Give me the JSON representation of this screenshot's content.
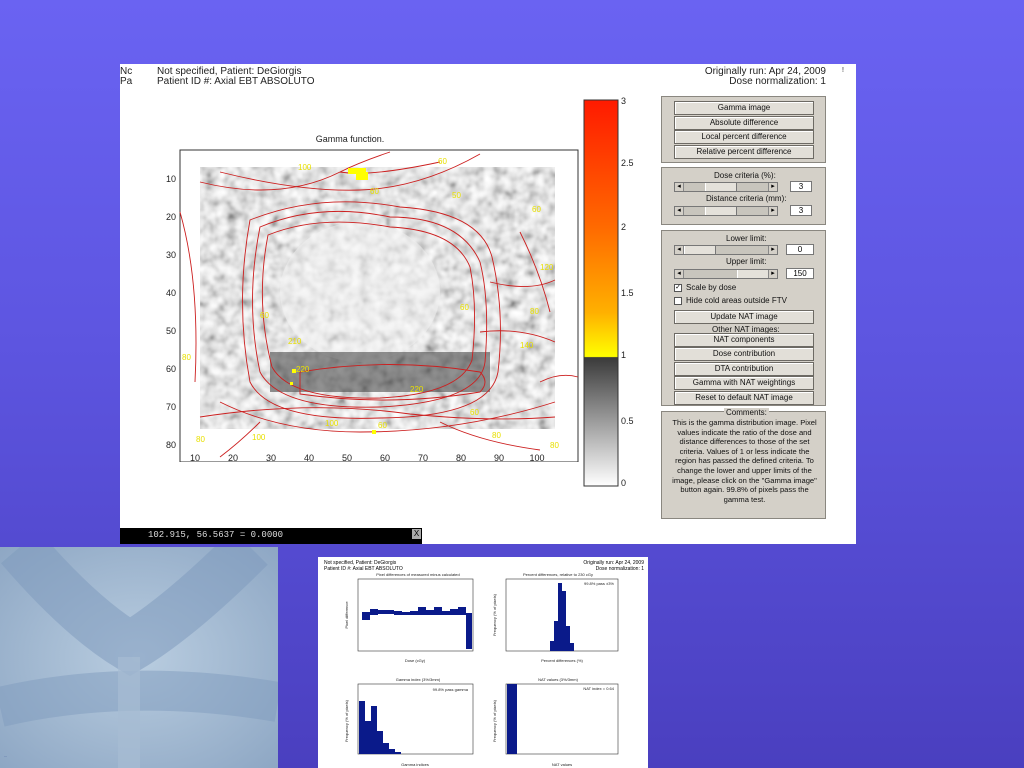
{
  "header": {
    "left_cut_1": "Nc",
    "left_cut_2": "Pa",
    "line1": "Not specified, Patient: DeGiorgis",
    "line2": "Patient ID #: Axial EBT ABSOLUTO",
    "orig_run": "Originally run: Apr 24, 2009",
    "dose_norm": "Dose normalization: 1",
    "corner_mark": "!"
  },
  "plot": {
    "title": "Gamma function.",
    "y_ticks": [
      "10",
      "20",
      "30",
      "40",
      "50",
      "60",
      "70",
      "80"
    ],
    "x_ticks": [
      "10",
      "20",
      "30",
      "40",
      "50",
      "60",
      "70",
      "80",
      "90",
      "100"
    ],
    "contour_labels": [
      "100",
      "60",
      "60",
      "50",
      "120",
      "60",
      "60",
      "210",
      "220",
      "80",
      "140",
      "220",
      "100",
      "60",
      "80",
      "80",
      "60",
      "100",
      "80",
      "80",
      "60"
    ]
  },
  "colorbar": {
    "ticks": [
      "3",
      "2.5",
      "2",
      "1.5",
      "1",
      "0.5",
      "0"
    ],
    "colors": {
      "top": "#ff1a00",
      "mid": "#ff9a00",
      "yellow": "#ffff00",
      "gray_dark": "#3a3a3a",
      "white": "#ffffff"
    }
  },
  "panel1": {
    "buttons": [
      "Gamma image",
      "Absolute difference",
      "Local percent difference",
      "Relative percent difference"
    ]
  },
  "panel2": {
    "dose_label": "Dose criteria (%):",
    "dose_value": "3",
    "dist_label": "Distance criteria (mm):",
    "dist_value": "3"
  },
  "panel3": {
    "lower_label": "Lower limit:",
    "lower_value": "0",
    "upper_label": "Upper limit:",
    "upper_value": "150",
    "scale_by_dose": "Scale by dose",
    "scale_checked": "✓",
    "hide_cold": "Hide cold areas outside FTV",
    "update_btn": "Update NAT image",
    "other_label": "Other NAT images:",
    "buttons": [
      "NAT components",
      "Dose contribution",
      "DTA contribution",
      "Gamma with NAT weightings",
      "Reset to default NAT image"
    ]
  },
  "comments": {
    "title": "Comments:",
    "text": "This is the gamma distribution image.  Pixel values indicate the ratio of the dose and distance differences to those of the set criteria.  Values of 1 or less indicate the region has passed the defined criteria.  To change the lower and upper limits of the image, please click on the \"Gamma image\" button again.  99.8% of pixels pass the gamma test."
  },
  "statusbar": {
    "readout": "102.915, 56.5637 = 0.0000",
    "close": "X"
  },
  "thumb_right": {
    "hdr1": "Not specified, Patient: DeGiorgis",
    "hdr2": "Patient ID #: Axial EBT ABSOLUTO",
    "orig": "Originally run: Apr 24, 2009",
    "norm": "Dose normalization: 1",
    "p1_title": "Pixel differences of measured minus calculated",
    "p1_xlabel": "Dose (cGy)",
    "p1_ylabel": "Pixel difference",
    "p2_title": "Percent differences, relative to 230 cGy",
    "p2_legend": "99.8% pass ±3%",
    "p2_xlabel": "Percent differences (%)",
    "p2_ylabel": "Frequency (% of pixels)",
    "p3_title": "Gamma index (3%/3mm)",
    "p3_legend": "99.8% pass gamma",
    "p3_xlabel": "Gamma indices",
    "p3_ylabel": "Frequency (% of pixels)",
    "p4_title": "NAT values (3%/3mm)",
    "p4_legend": "NAT index = 0.64",
    "p4_xlabel": "NAT values",
    "p4_ylabel": "Frequency (% of pixels)"
  },
  "thumb_left": {
    "caption": "..."
  }
}
